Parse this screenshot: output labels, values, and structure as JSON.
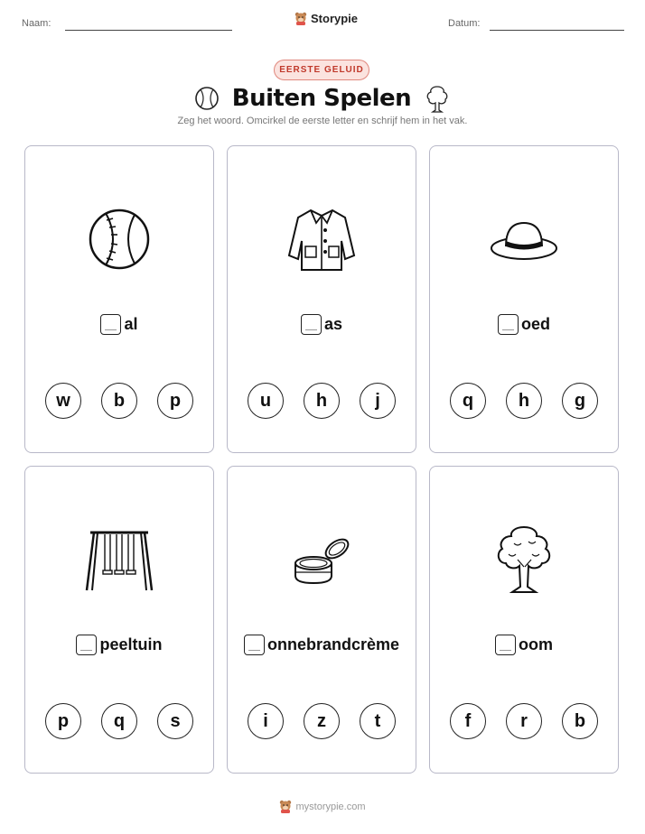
{
  "header": {
    "name_label": "Naam:",
    "date_label": "Datum:",
    "brand": "Storypie"
  },
  "badge": "EERSTE GELUID",
  "title": "Buiten Spelen",
  "subtitle": "Zeg het woord. Omcirkel de eerste letter en schrijf hem in het vak.",
  "cards": [
    {
      "icon": "baseball-icon",
      "word": "al",
      "choices": [
        "w",
        "b",
        "p"
      ]
    },
    {
      "icon": "jacket-icon",
      "word": "as",
      "choices": [
        "u",
        "h",
        "j"
      ]
    },
    {
      "icon": "sun-hat-icon",
      "word": "oed",
      "choices": [
        "q",
        "h",
        "g"
      ]
    },
    {
      "icon": "swing-set-icon",
      "word": "peeltuin",
      "choices": [
        "p",
        "q",
        "s"
      ]
    },
    {
      "icon": "sunscreen-jar-icon",
      "word": "onnebrandcrème",
      "choices": [
        "i",
        "z",
        "t"
      ]
    },
    {
      "icon": "tree-icon",
      "word": "oom",
      "choices": [
        "f",
        "r",
        "b"
      ]
    }
  ],
  "footer": "mystorypie.com"
}
